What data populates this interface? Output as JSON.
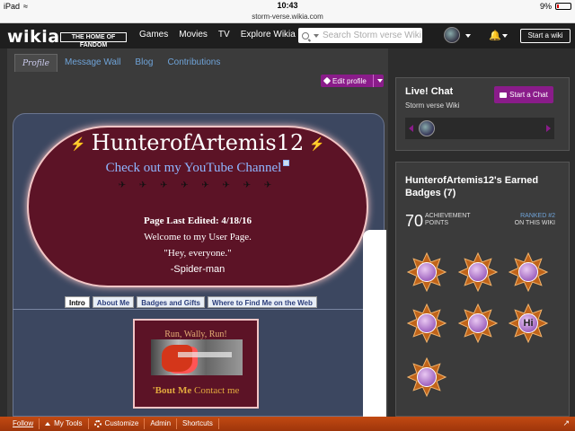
{
  "status_bar": {
    "device": "iPad",
    "time": "10:43",
    "battery": "9%",
    "url": "storm-verse.wikia.com"
  },
  "global_nav": {
    "logo": "wikia",
    "tagline": "THE HOME OF FANDOM",
    "links": [
      "Games",
      "Movies",
      "TV",
      "Explore Wikia"
    ],
    "search_placeholder": "Search Storm verse Wiki",
    "start_wiki": "Start a wiki"
  },
  "tabs": {
    "profile": "Profile",
    "message_wall": "Message Wall",
    "blog": "Blog",
    "contributions": "Contributions"
  },
  "edit_profile": "Edit profile",
  "profile": {
    "username": "HunterofArtemis12",
    "youtube_link": "Check out my YouTube Channel",
    "birds": "✈ ✈ ✈ ✈ ✈ ✈ ✈ ✈",
    "last_edited": "Page Last Edited: 4/18/16",
    "welcome": "Welcome to my User Page.",
    "quote": "\"Hey, everyone.\"",
    "attribution": "-Spider-man",
    "subtabs": [
      "Intro",
      "About Me",
      "Badges and Gifts",
      "Where to Find Me on the Web"
    ],
    "box_heading": "Run, Wally, Run!",
    "bout_me": "'Bout Me",
    "contact_me": "Contact me"
  },
  "chat": {
    "title": "Live! Chat",
    "wiki": "Storm verse Wiki",
    "start_chat": "Start a Chat"
  },
  "badges": {
    "title": "HunterofArtemis12's Earned Badges (7)",
    "points": "70",
    "points_label_1": "ACHIEVEMENT",
    "points_label_2": "POINTS",
    "rank_1": "RANKED #2",
    "rank_2": "ON THIS WIKI",
    "items": [
      {
        "icon": "quill-icon",
        "sym": ""
      },
      {
        "icon": "pencil-icon",
        "sym": ""
      },
      {
        "icon": "sparkle-icon",
        "sym": ""
      },
      {
        "icon": "eraser-icon",
        "sym": ""
      },
      {
        "icon": "calendar-icon",
        "sym": ""
      },
      {
        "icon": "hi-speech-icon",
        "sym": "Hi"
      },
      {
        "icon": "tomato-icon",
        "sym": ""
      }
    ]
  },
  "toolbar": {
    "follow": "Follow",
    "my_tools": "My Tools",
    "customize": "Customize",
    "admin": "Admin",
    "shortcuts": "Shortcuts"
  },
  "colors": {
    "accent_purple": "#8a1c8a",
    "profile_maroon": "#5c1326",
    "toolbar_orange": "#b4400f",
    "link_blue": "#6fa3d8"
  }
}
